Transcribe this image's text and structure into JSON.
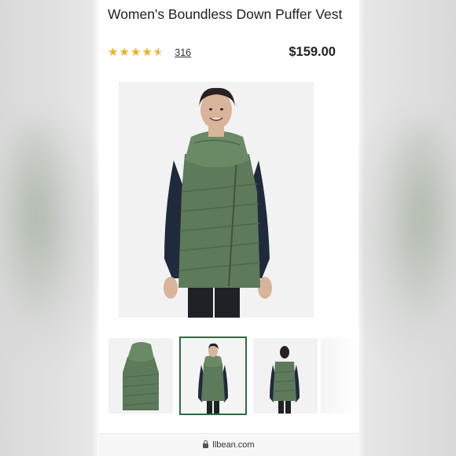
{
  "product": {
    "title": "Women's Boundless Down Puffer Vest",
    "rating_value": 4.5,
    "rating_max": 5,
    "review_count": "316",
    "price": "$159.00"
  },
  "images": {
    "hero_alt_icon": "product-photo-model-front",
    "thumbnails": [
      {
        "name": "vest-flat",
        "selected": false
      },
      {
        "name": "model-front",
        "selected": true
      },
      {
        "name": "model-back",
        "selected": false
      }
    ]
  },
  "browser": {
    "url": "llbean.com"
  },
  "colors": {
    "vest_green": "#5d7a5a",
    "star_gold": "#f1b11a",
    "selected_outline": "#2f6b3f"
  }
}
